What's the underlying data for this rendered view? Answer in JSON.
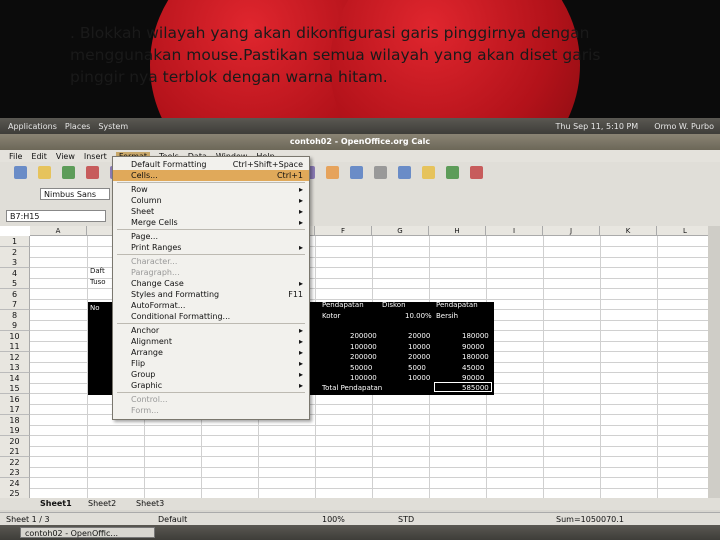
{
  "slide": {
    "text": ". Blokkah wilayah yang akan dikonfigurasi garis pinggirnya dengan menggunakan mouse.Pastikan semua wilayah yang akan diset garis pinggir nya terblok dengan warna hitam."
  },
  "topbar": {
    "apps": "Applications",
    "places": "Places",
    "system": "System",
    "clock": "Thu Sep 11, 5:10 PM",
    "user": "Ormo W. Purbo"
  },
  "window": {
    "title": "contoh02 - OpenOffice.org Calc"
  },
  "menubar": [
    "File",
    "Edit",
    "View",
    "Insert",
    "Format",
    "Tools",
    "Data",
    "Window",
    "Help"
  ],
  "toolbar": {
    "font_name": "Nimbus Sans"
  },
  "formula": {
    "namebox": "B7:H15"
  },
  "grid": {
    "columns": [
      "A",
      "B",
      "C",
      "D",
      "E",
      "F",
      "G",
      "H",
      "I",
      "J",
      "K",
      "L"
    ],
    "rows": [
      "1",
      "2",
      "3",
      "4",
      "5",
      "6",
      "7",
      "8",
      "9",
      "10",
      "11",
      "12",
      "13",
      "14",
      "15",
      "16",
      "17",
      "18",
      "19",
      "20",
      "21",
      "22",
      "23",
      "24",
      "25"
    ],
    "b4": "Daft",
    "b5": "Tuso",
    "b7": "No",
    "header_g7": "Pendapatan",
    "header_h7": "Diskon",
    "header_i7": "Pendapatan",
    "header_g8": "Kotor",
    "header_h8": "10.00%",
    "header_i8": "Bersih",
    "values_g": [
      "200000",
      "100000",
      "200000",
      "50000",
      "100000"
    ],
    "values_h": [
      "20000",
      "10000",
      "20000",
      "5000",
      "10000"
    ],
    "values_i": [
      "180000",
      "90000",
      "180000",
      "45000",
      "90000"
    ],
    "total_label": "Total Pendapatan",
    "total_value": "585000"
  },
  "format_menu": [
    {
      "label": "Default Formatting",
      "acc": "Ctrl+Shift+Space",
      "state": "normal"
    },
    {
      "label": "Cells...",
      "acc": "Ctrl+1",
      "state": "highlighted"
    },
    {
      "label": "Row",
      "acc": "▸",
      "state": "normal"
    },
    {
      "label": "Column",
      "acc": "▸",
      "state": "normal"
    },
    {
      "label": "Sheet",
      "acc": "▸",
      "state": "normal"
    },
    {
      "label": "Merge Cells",
      "acc": "▸",
      "state": "normal"
    },
    {
      "label": "Page...",
      "acc": "",
      "state": "normal"
    },
    {
      "label": "Print Ranges",
      "acc": "▸",
      "state": "normal"
    },
    {
      "label": "Character...",
      "acc": "",
      "state": "disabled"
    },
    {
      "label": "Paragraph...",
      "acc": "",
      "state": "disabled"
    },
    {
      "label": "Change Case",
      "acc": "▸",
      "state": "normal"
    },
    {
      "label": "Styles and Formatting",
      "acc": "F11",
      "state": "normal"
    },
    {
      "label": "AutoFormat...",
      "acc": "",
      "state": "normal"
    },
    {
      "label": "Conditional Formatting...",
      "acc": "",
      "state": "normal"
    },
    {
      "label": "Anchor",
      "acc": "▸",
      "state": "normal"
    },
    {
      "label": "Alignment",
      "acc": "▸",
      "state": "normal"
    },
    {
      "label": "Arrange",
      "acc": "▸",
      "state": "normal"
    },
    {
      "label": "Flip",
      "acc": "▸",
      "state": "normal"
    },
    {
      "label": "Group",
      "acc": "▸",
      "state": "normal"
    },
    {
      "label": "Graphic",
      "acc": "▸",
      "state": "normal"
    },
    {
      "label": "Control...",
      "acc": "",
      "state": "disabled"
    },
    {
      "label": "Form...",
      "acc": "",
      "state": "disabled"
    }
  ],
  "sheets": [
    "Sheet1",
    "Sheet2",
    "Sheet3"
  ],
  "status": {
    "sheet": "Sheet 1 / 3",
    "style": "Default",
    "zoom": "100%",
    "mode": "STD",
    "sum": "Sum=1050070.1"
  },
  "taskbar": {
    "item": "contoh02 - OpenOffic..."
  }
}
